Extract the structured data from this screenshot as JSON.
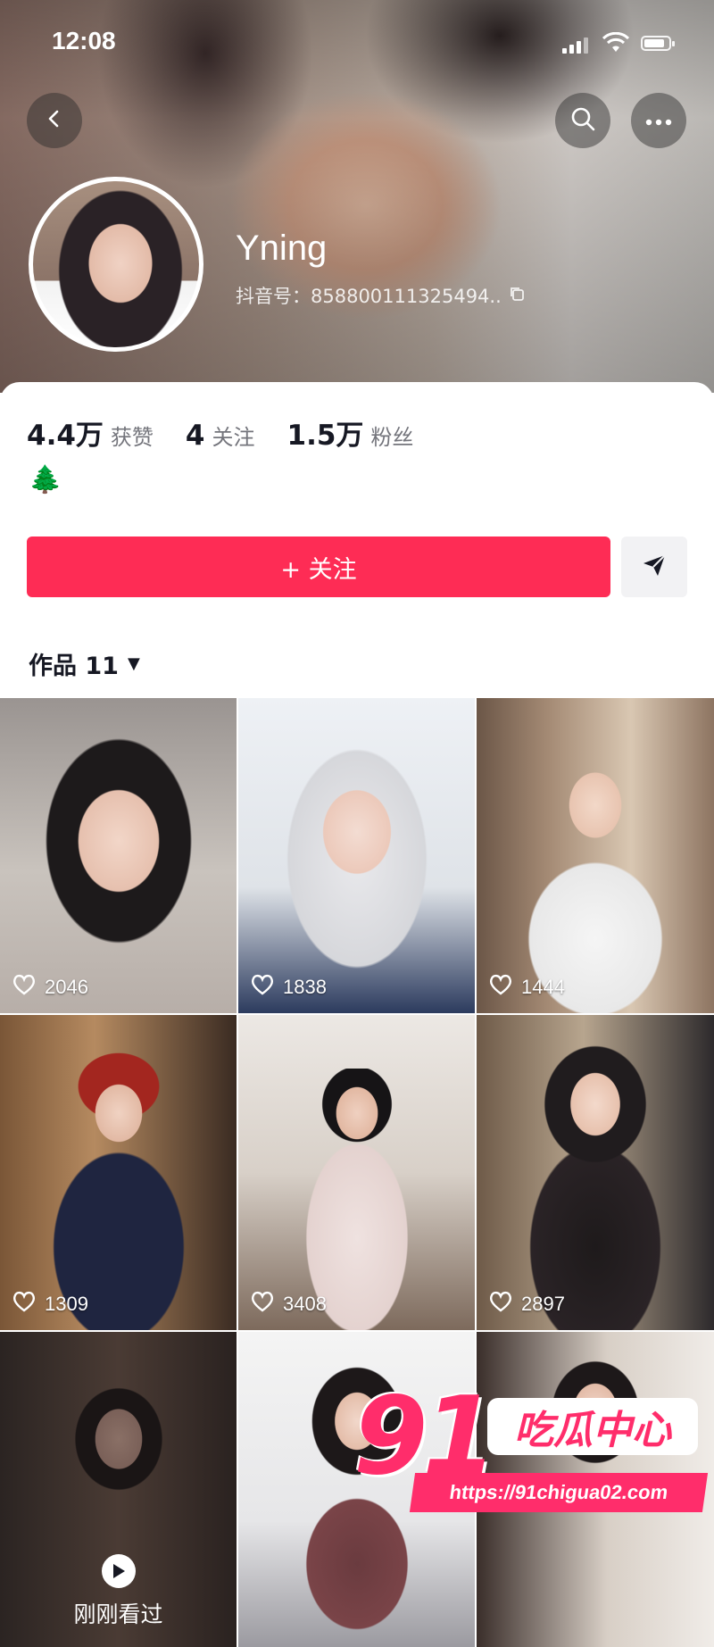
{
  "status_bar": {
    "time": "12:08"
  },
  "profile": {
    "username": "Yning",
    "douyin_id": "抖音号：858800111325494..",
    "signature": "🌲",
    "stats": [
      {
        "value": "4.4万",
        "label": "获赞"
      },
      {
        "value": "4",
        "label": "关注"
      },
      {
        "value": "1.5万",
        "label": "粉丝"
      }
    ]
  },
  "actions": {
    "follow_label": "+ 关注"
  },
  "works_tab": {
    "label": "作品 11",
    "caret": "▼"
  },
  "videos": [
    {
      "likes": "2046"
    },
    {
      "likes": "1838"
    },
    {
      "likes": "1444"
    },
    {
      "likes": "1309"
    },
    {
      "likes": "3408"
    },
    {
      "likes": "2897"
    },
    {
      "watched_label": "刚刚看过"
    },
    {},
    {}
  ],
  "watermark": {
    "number": "91",
    "title": "吃瓜中心",
    "url": "https://91chigua02.com"
  },
  "colors": {
    "accent": "#fe2c55",
    "watermark": "#ff2d6b"
  }
}
